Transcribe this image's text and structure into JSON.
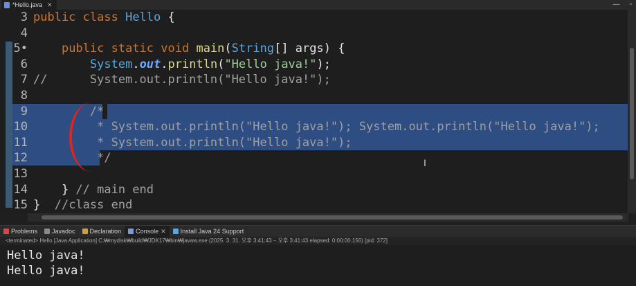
{
  "tab": {
    "label": "*Hello.java"
  },
  "window": {
    "min": "—",
    "max": "▫"
  },
  "editor_lines": [
    {
      "num": "3",
      "parts": [
        [
          "kw",
          "public "
        ],
        [
          "kw",
          "class "
        ],
        [
          "cls",
          "Hello "
        ],
        [
          "plain",
          "{"
        ]
      ]
    },
    {
      "num": "4",
      "parts": []
    },
    {
      "num": "5•",
      "parts": [
        [
          "plain",
          "    "
        ],
        [
          "kw",
          "public "
        ],
        [
          "kw",
          "static "
        ],
        [
          "kw",
          "void "
        ],
        [
          "mth",
          "main"
        ],
        [
          "plain",
          "("
        ],
        [
          "cls",
          "String"
        ],
        [
          "plain",
          "[] "
        ],
        [
          "plain",
          "args) {"
        ]
      ]
    },
    {
      "num": "6",
      "parts": [
        [
          "plain",
          "        "
        ],
        [
          "cls",
          "System"
        ],
        [
          "plain",
          "."
        ],
        [
          "fld",
          "out"
        ],
        [
          "plain",
          "."
        ],
        [
          "mth",
          "println"
        ],
        [
          "plain",
          "("
        ],
        [
          "str",
          "\"Hello java!\""
        ],
        [
          "plain",
          ");"
        ]
      ]
    },
    {
      "num": "7",
      "parts": [
        [
          "cmt",
          "//      System.out.println(\"Hello java!\");"
        ]
      ]
    },
    {
      "num": "8",
      "parts": []
    },
    {
      "num": "9",
      "parts": [
        [
          "cmt",
          "        /*"
        ]
      ]
    },
    {
      "num": "10",
      "parts": [
        [
          "cmt",
          "         * System.out.println(\"Hello java!\"); System.out.println(\"Hello java!\");"
        ]
      ]
    },
    {
      "num": "11",
      "parts": [
        [
          "cmt",
          "         * System.out.println(\"Hello java!\");"
        ]
      ]
    },
    {
      "num": "12",
      "parts": [
        [
          "cmt",
          "         */"
        ]
      ]
    },
    {
      "num": "13",
      "parts": []
    },
    {
      "num": "14",
      "parts": [
        [
          "plain",
          "    } "
        ],
        [
          "cmt",
          "// main end"
        ]
      ]
    },
    {
      "num": "15",
      "parts": [
        [
          "plain",
          "}  "
        ],
        [
          "cmt",
          "//class end"
        ]
      ]
    }
  ],
  "panel_tabs": [
    {
      "label": "Problems",
      "icon": "problems-icon",
      "color": "#d24b4b"
    },
    {
      "label": "Javadoc",
      "icon": "javadoc-icon",
      "color": "#8a8a8a"
    },
    {
      "label": "Declaration",
      "icon": "declaration-icon",
      "color": "#c9a04a"
    },
    {
      "label": "Console",
      "icon": "console-icon",
      "color": "#7b9bd6",
      "active": true
    },
    {
      "label": "Install Java 24 Support",
      "icon": "info-icon",
      "color": "#5aa7de"
    }
  ],
  "status": "<terminated> Hello [Java Application] C:₩mydisk₩build₩JDK17₩bin₩javaw.exe  (2025. 3. 31. 오후 3:41:43 – 오후 3:41:43 elapsed: 0:00:00.156) [pid: 372]",
  "console_lines": [
    "Hello java!",
    "Hello java!"
  ]
}
